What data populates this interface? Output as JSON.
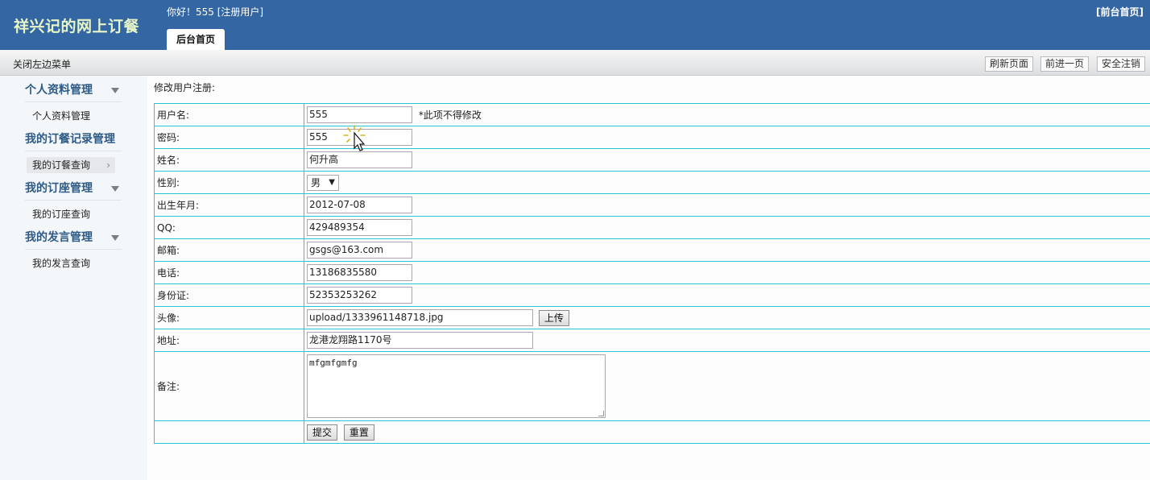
{
  "header": {
    "site_title": "祥兴记的网上订餐",
    "greeting": "你好！555 [注册用户]",
    "front_link": "[前台首页]",
    "active_tab": "后台首页"
  },
  "subbar": {
    "close_menu": "关闭左边菜单",
    "buttons": [
      "刷新页面",
      "前进一页",
      "安全注销"
    ]
  },
  "sidebar": {
    "groups": [
      {
        "title": "个人资料管理",
        "items": [
          "个人资料管理"
        ]
      },
      {
        "title": "我的订餐记录管理",
        "items": [
          "我的订餐查询"
        ]
      },
      {
        "title": "我的订座管理",
        "items": [
          "我的订座查询"
        ]
      },
      {
        "title": "我的发言管理",
        "items": [
          "我的发言查询"
        ]
      }
    ]
  },
  "form": {
    "page_label": "修改用户注册:",
    "fields": {
      "username": {
        "label": "用户名:",
        "value": "555",
        "note": "*此项不得修改"
      },
      "password": {
        "label": "密码:",
        "value": "555"
      },
      "name": {
        "label": "姓名:",
        "value": "何升高"
      },
      "gender": {
        "label": "性别:",
        "value": "男"
      },
      "birth": {
        "label": "出生年月:",
        "value": "2012-07-08"
      },
      "qq": {
        "label": "QQ:",
        "value": "429489354"
      },
      "email": {
        "label": "邮箱:",
        "value": "gsgs@163.com"
      },
      "phone": {
        "label": "电话:",
        "value": "13186835580"
      },
      "id_card": {
        "label": "身份证:",
        "value": "52353253262"
      },
      "avatar": {
        "label": "头像:",
        "value": "upload/1333961148718.jpg",
        "upload_label": "上传"
      },
      "address": {
        "label": "地址:",
        "value": "龙港龙翔路1170号"
      },
      "remark": {
        "label": "备注:",
        "value": "mfgmfgmfg"
      }
    },
    "submit_label": "提交",
    "reset_label": "重置"
  },
  "colors": {
    "header_bg": "#3366a2",
    "title_color": "#e8f6c7",
    "table_border": "#26c6d8",
    "menu_title": "#2d5a86"
  }
}
